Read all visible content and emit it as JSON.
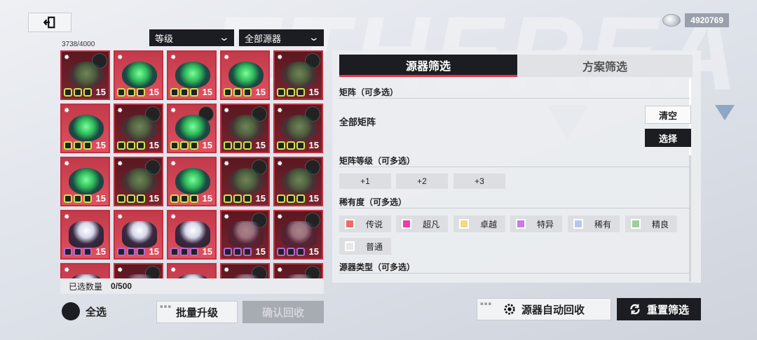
{
  "currency": {
    "value": "4920769",
    "icon": "coin-icon"
  },
  "dropdowns": {
    "sort": "等级",
    "filter": "全部源器"
  },
  "inventory": {
    "count": "3738/4000"
  },
  "grid": {
    "cells": [
      {
        "state": "dim",
        "core": "green",
        "badge": true,
        "dots": "green",
        "level": "15"
      },
      {
        "state": "sel",
        "core": "green",
        "badge": false,
        "dots": "green",
        "level": "15"
      },
      {
        "state": "sel",
        "core": "green",
        "badge": false,
        "dots": "green",
        "level": "15"
      },
      {
        "state": "sel",
        "core": "green",
        "badge": false,
        "dots": "green",
        "level": "15"
      },
      {
        "state": "dim",
        "core": "green",
        "badge": true,
        "dots": "green",
        "level": "15"
      },
      {
        "state": "sel",
        "core": "green",
        "badge": false,
        "dots": "green",
        "level": "15"
      },
      {
        "state": "dim",
        "core": "green",
        "badge": true,
        "dots": "green",
        "level": "15"
      },
      {
        "state": "sel",
        "core": "green",
        "badge": true,
        "dots": "green",
        "level": "15"
      },
      {
        "state": "dim",
        "core": "green",
        "badge": true,
        "dots": "green",
        "level": "15"
      },
      {
        "state": "dim",
        "core": "green",
        "badge": true,
        "dots": "green",
        "level": "15"
      },
      {
        "state": "sel",
        "core": "green",
        "badge": false,
        "dots": "green",
        "level": "15"
      },
      {
        "state": "dim",
        "core": "green",
        "badge": true,
        "dots": "green",
        "level": "15"
      },
      {
        "state": "sel",
        "core": "green",
        "badge": false,
        "dots": "green",
        "level": "15"
      },
      {
        "state": "dim",
        "core": "green",
        "badge": true,
        "dots": "green",
        "level": "15"
      },
      {
        "state": "dim",
        "core": "green",
        "badge": true,
        "dots": "green",
        "level": "15"
      },
      {
        "state": "sel",
        "core": "purple",
        "badge": false,
        "dots": "purple",
        "level": "15"
      },
      {
        "state": "sel",
        "core": "purple",
        "badge": false,
        "dots": "purple",
        "level": "15"
      },
      {
        "state": "sel",
        "core": "purple",
        "badge": false,
        "dots": "purple",
        "level": "15"
      },
      {
        "state": "dim",
        "core": "purple",
        "badge": true,
        "dots": "purple",
        "level": "15"
      },
      {
        "state": "dim",
        "core": "purple",
        "badge": true,
        "dots": "purple",
        "level": "15"
      },
      {
        "state": "sel",
        "core": "purple",
        "badge": false,
        "dots": "purple",
        "level": ""
      },
      {
        "state": "dim",
        "core": "purple",
        "badge": true,
        "dots": "purple",
        "level": ""
      },
      {
        "state": "sel",
        "core": "purple",
        "badge": false,
        "dots": "purple",
        "level": ""
      },
      {
        "state": "dim",
        "core": "purple",
        "badge": true,
        "dots": "purple",
        "level": ""
      },
      {
        "state": "dim",
        "core": "purple",
        "badge": true,
        "dots": "purple",
        "level": ""
      }
    ]
  },
  "selected": {
    "label": "已选数量",
    "value": "0/500"
  },
  "bottom": {
    "select_all": "全选",
    "batch_upgrade": "批量升级",
    "confirm_recycle": "确认回收",
    "auto_recycle": "源器自动回收",
    "reset_filter": "重置筛选"
  },
  "panel": {
    "tabs": [
      "源器筛选",
      "方案筛选"
    ],
    "matrix_title": "矩阵（可多选）",
    "all_matrix": "全部矩阵",
    "clear": "清空",
    "choose": "选择",
    "matrix_level_title": "矩阵等级（可多选）",
    "levels": [
      "+1",
      "+2",
      "+3"
    ],
    "rarity_title": "稀有度（可多选）",
    "rarities": [
      {
        "label": "传说",
        "color": "#f06a6a"
      },
      {
        "label": "超凡",
        "color": "#f03ab0"
      },
      {
        "label": "卓越",
        "color": "#f5d78a"
      },
      {
        "label": "特异",
        "color": "#c77ae8"
      },
      {
        "label": "稀有",
        "color": "#b8c6ee"
      },
      {
        "label": "精良",
        "color": "#9fcf9a"
      },
      {
        "label": "普通",
        "color": "#e8e8e8"
      }
    ],
    "type_title": "源器类型（可多选）"
  }
}
